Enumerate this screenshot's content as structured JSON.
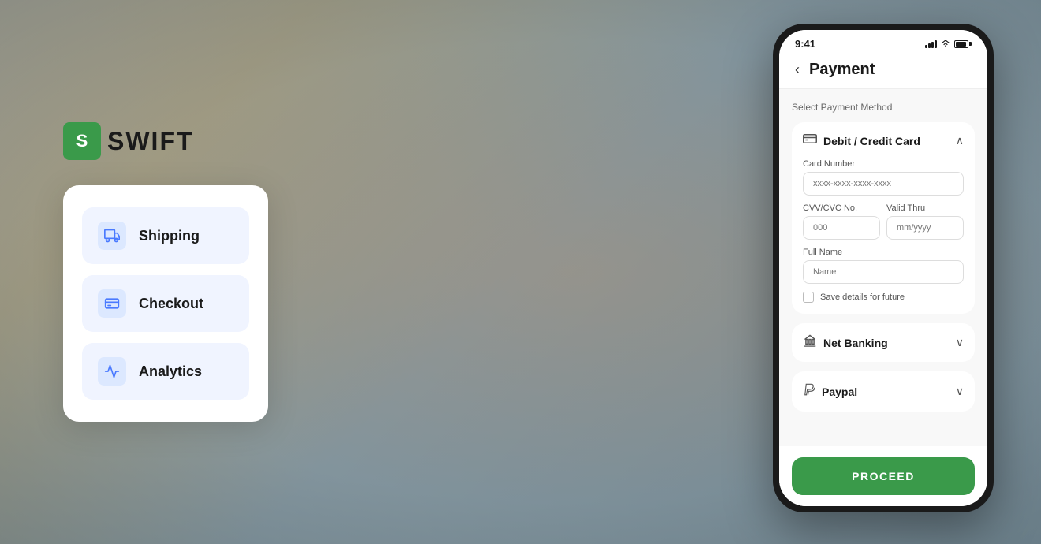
{
  "logo": {
    "icon_letter": "S",
    "name": "SWIFT"
  },
  "menu": {
    "items": [
      {
        "id": "shipping",
        "label": "Shipping",
        "icon": "shipping-icon"
      },
      {
        "id": "checkout",
        "label": "Checkout",
        "icon": "checkout-icon"
      },
      {
        "id": "analytics",
        "label": "Analytics",
        "icon": "analytics-icon"
      }
    ]
  },
  "phone": {
    "status_time": "9:41",
    "header_back": "‹",
    "header_title": "Payment",
    "select_method_label": "Select Payment Method",
    "payment_methods": [
      {
        "id": "debit-credit",
        "label": "Debit / Credit Card",
        "expanded": true,
        "chevron": "∧"
      },
      {
        "id": "net-banking",
        "label": "Net Banking",
        "expanded": false,
        "chevron": "∨"
      },
      {
        "id": "paypal",
        "label": "Paypal",
        "expanded": false,
        "chevron": "∨"
      }
    ],
    "card_form": {
      "card_number_label": "Card Number",
      "card_number_placeholder": "xxxx-xxxx-xxxx-xxxx",
      "cvv_label": "CVV/CVC No.",
      "cvv_placeholder": "000",
      "valid_thru_label": "Valid Thru",
      "valid_thru_placeholder": "mm/yyyy",
      "full_name_label": "Full Name",
      "full_name_placeholder": "Name",
      "save_details_label": "Save details for future"
    },
    "proceed_button_label": "PROCEED"
  },
  "colors": {
    "green_accent": "#3a9a4a",
    "icon_bg": "#dce8ff",
    "menu_item_bg": "#f0f4ff",
    "card_bg": "#ffffff"
  }
}
